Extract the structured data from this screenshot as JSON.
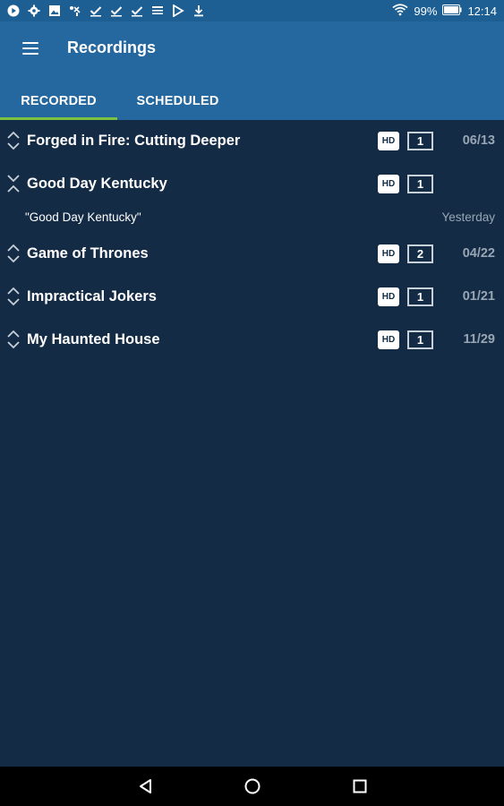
{
  "status_bar": {
    "battery": "99%",
    "time": "12:14",
    "icons": [
      "play-icon",
      "settings-icon",
      "image-icon",
      "signal-icon",
      "check-icon",
      "check-icon",
      "check-icon",
      "cast-icon",
      "play-store-icon",
      "download-icon"
    ]
  },
  "app_bar": {
    "title": "Recordings"
  },
  "tabs": [
    {
      "label": "RECORDED",
      "active": true
    },
    {
      "label": "SCHEDULED",
      "active": false
    }
  ],
  "recordings": [
    {
      "title": "Forged in Fire: Cutting Deeper",
      "hd": "HD",
      "count": "1",
      "date": "06/13"
    },
    {
      "title": "Good Day Kentucky",
      "hd": "HD",
      "count": "1",
      "date": "",
      "episode": "\"Good Day Kentucky\"",
      "episode_date": "Yesterday"
    },
    {
      "title": "Game of Thrones",
      "hd": "HD",
      "count": "2",
      "date": "04/22"
    },
    {
      "title": "Impractical Jokers",
      "hd": "HD",
      "count": "1",
      "date": "01/21"
    },
    {
      "title": "My Haunted House",
      "hd": "HD",
      "count": "1",
      "date": "11/29"
    }
  ],
  "colors": {
    "status_bar": "#1d5f93",
    "app_bar": "#2568a0",
    "background": "#142b45",
    "tab_indicator": "#7cc13f"
  }
}
